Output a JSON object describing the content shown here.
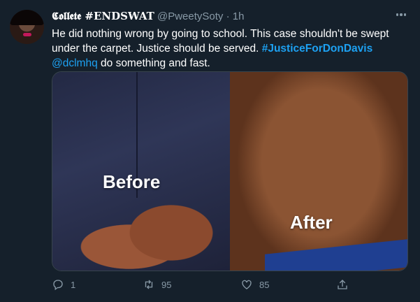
{
  "tweet": {
    "display_name": "𝕮𝖔𝖑𝖑𝖊𝖙𝖊 #ENDSWAT",
    "handle": "@PweetySoty",
    "separator": "·",
    "time": "1h",
    "text_main": "He did nothing wrong by going to school. This case shouldn't be swept under the carpet. Justice should be served.",
    "hashtag": "#JusticeForDonDavis",
    "mention": "@dclmhq",
    "text_tail": "do something and fast."
  },
  "media": {
    "before_label": "Before",
    "after_label": "After"
  },
  "actions": {
    "reply_count": "1",
    "retweet_count": "95",
    "like_count": "85"
  },
  "icons": {
    "more": "more-dots-icon",
    "reply": "reply-icon",
    "retweet": "retweet-icon",
    "like": "heart-icon",
    "share": "share-icon"
  },
  "colors": {
    "background": "#15202b",
    "link": "#1da1f2",
    "muted": "#8899a6"
  }
}
